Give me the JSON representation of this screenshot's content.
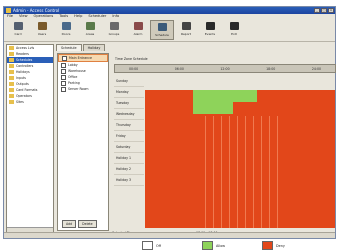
{
  "window": {
    "title": "Admin - Access Control"
  },
  "menu": [
    "File",
    "View",
    "Operations",
    "Tools",
    "Help",
    "Scheduler",
    "Info"
  ],
  "toolbar": [
    {
      "label": "Card",
      "icon": "card-icon"
    },
    {
      "label": "Users",
      "icon": "users-icon"
    },
    {
      "label": "Doors",
      "icon": "door-icon"
    },
    {
      "label": "Areas",
      "icon": "area-icon"
    },
    {
      "label": "Groups",
      "icon": "groups-icon"
    },
    {
      "label": "Alarm",
      "icon": "alarm-icon"
    },
    {
      "label": "Schedule",
      "icon": "schedule-icon"
    },
    {
      "label": "Report",
      "icon": "report-icon"
    },
    {
      "label": "Events",
      "icon": "events-icon"
    },
    {
      "label": "Exit",
      "icon": "exit-icon"
    }
  ],
  "tree": [
    "Access Lvls",
    "Readers",
    "Schedules",
    "Controllers",
    "Holidays",
    "Inputs",
    "Outputs",
    "Card Formats",
    "Operators",
    "Sites"
  ],
  "tabs": [
    "Schedule",
    "Holiday"
  ],
  "group_list": [
    "Main Entrance",
    "Lobby",
    "Warehouse",
    "Office",
    "Parking",
    "Server Room"
  ],
  "group_buttons": {
    "add": "Add",
    "delete": "Delete"
  },
  "sched_header": "Time Zone Schedule",
  "time_ticks": [
    "00:00",
    "06:00",
    "12:00",
    "18:00",
    "24:00"
  ],
  "days": [
    "Sunday",
    "Monday",
    "Tuesday",
    "Wednesday",
    "Thursday",
    "Friday",
    "Saturday",
    "Holiday 1",
    "Holiday 2",
    "Holiday 3"
  ],
  "selection": {
    "label": "Selected Time",
    "value": "07:00 - 17:00"
  },
  "legend": [
    {
      "label": "Off",
      "color": "#ffffff"
    },
    {
      "label": "Allow",
      "color": "#8ed35a"
    },
    {
      "label": "Deny",
      "color": "#e2471a"
    }
  ]
}
